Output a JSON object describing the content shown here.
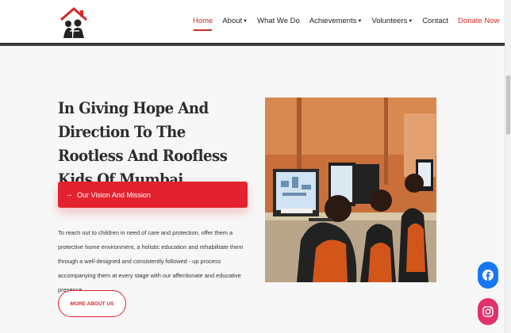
{
  "nav": {
    "items": [
      {
        "label": "Home",
        "dropdown": false,
        "active": true
      },
      {
        "label": "About",
        "dropdown": true
      },
      {
        "label": "What We Do",
        "dropdown": false
      },
      {
        "label": "Achievements",
        "dropdown": true
      },
      {
        "label": "Volunteers",
        "dropdown": true
      },
      {
        "label": "Contact",
        "dropdown": false
      }
    ],
    "donate_label": "Donate Now"
  },
  "hero": {
    "title": "In Giving Hope And Direction To The Rootless And Roofless Kids Of Mumbai",
    "vision_button": "Our Vision And Mission",
    "description": "To reach out to children in need of care and protection, offer them a protective home environment, a holistic education and rehabilitate them through a well-designed and consistently followed - up process accompanying them at every stage with our affectionate and educative presence.",
    "more_button": "MORE ABOUT US"
  },
  "icons": {
    "logo": "house-family-logo",
    "vision_arrow": "arrow-right-icon",
    "facebook": "facebook-icon",
    "instagram": "instagram-icon"
  },
  "colors": {
    "accent": "#e2222e",
    "facebook": "#1877f2",
    "instagram": "#e1306c"
  }
}
